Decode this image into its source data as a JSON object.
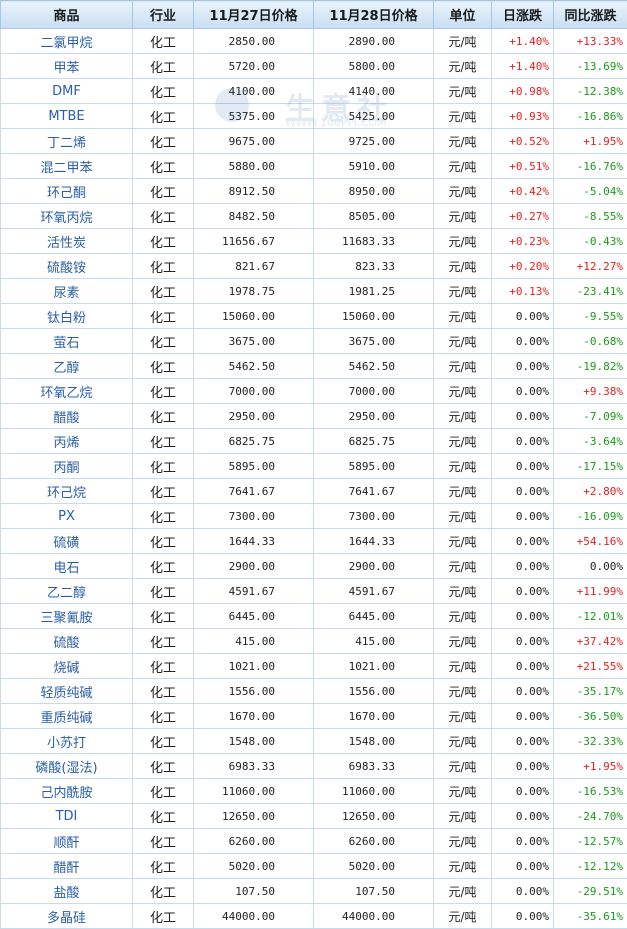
{
  "headers": [
    "商品",
    "行业",
    "11月27日价格",
    "11月28日价格",
    "单位",
    "日涨跌",
    "同比涨跌"
  ],
  "watermark": {
    "brand": "生意社",
    "site": "WWW.100PPI.COM"
  },
  "rows": [
    {
      "name": "二氯甲烷",
      "industry": "化工",
      "p1": "2850.00",
      "p2": "2890.00",
      "unit": "元/吨",
      "day": "+1.40%",
      "yoy": "+13.33%"
    },
    {
      "name": "甲苯",
      "industry": "化工",
      "p1": "5720.00",
      "p2": "5800.00",
      "unit": "元/吨",
      "day": "+1.40%",
      "yoy": "-13.69%"
    },
    {
      "name": "DMF",
      "industry": "化工",
      "p1": "4100.00",
      "p2": "4140.00",
      "unit": "元/吨",
      "day": "+0.98%",
      "yoy": "-12.38%"
    },
    {
      "name": "MTBE",
      "industry": "化工",
      "p1": "5375.00",
      "p2": "5425.00",
      "unit": "元/吨",
      "day": "+0.93%",
      "yoy": "-16.86%"
    },
    {
      "name": "丁二烯",
      "industry": "化工",
      "p1": "9675.00",
      "p2": "9725.00",
      "unit": "元/吨",
      "day": "+0.52%",
      "yoy": "+1.95%"
    },
    {
      "name": "混二甲苯",
      "industry": "化工",
      "p1": "5880.00",
      "p2": "5910.00",
      "unit": "元/吨",
      "day": "+0.51%",
      "yoy": "-16.76%"
    },
    {
      "name": "环己酮",
      "industry": "化工",
      "p1": "8912.50",
      "p2": "8950.00",
      "unit": "元/吨",
      "day": "+0.42%",
      "yoy": "-5.04%"
    },
    {
      "name": "环氧丙烷",
      "industry": "化工",
      "p1": "8482.50",
      "p2": "8505.00",
      "unit": "元/吨",
      "day": "+0.27%",
      "yoy": "-8.55%"
    },
    {
      "name": "活性炭",
      "industry": "化工",
      "p1": "11656.67",
      "p2": "11683.33",
      "unit": "元/吨",
      "day": "+0.23%",
      "yoy": "-0.43%"
    },
    {
      "name": "硫酸铵",
      "industry": "化工",
      "p1": "821.67",
      "p2": "823.33",
      "unit": "元/吨",
      "day": "+0.20%",
      "yoy": "+12.27%"
    },
    {
      "name": "尿素",
      "industry": "化工",
      "p1": "1978.75",
      "p2": "1981.25",
      "unit": "元/吨",
      "day": "+0.13%",
      "yoy": "-23.41%"
    },
    {
      "name": "钛白粉",
      "industry": "化工",
      "p1": "15060.00",
      "p2": "15060.00",
      "unit": "元/吨",
      "day": "0.00%",
      "yoy": "-9.55%"
    },
    {
      "name": "萤石",
      "industry": "化工",
      "p1": "3675.00",
      "p2": "3675.00",
      "unit": "元/吨",
      "day": "0.00%",
      "yoy": "-0.68%"
    },
    {
      "name": "乙醇",
      "industry": "化工",
      "p1": "5462.50",
      "p2": "5462.50",
      "unit": "元/吨",
      "day": "0.00%",
      "yoy": "-19.82%"
    },
    {
      "name": "环氧乙烷",
      "industry": "化工",
      "p1": "7000.00",
      "p2": "7000.00",
      "unit": "元/吨",
      "day": "0.00%",
      "yoy": "+9.38%"
    },
    {
      "name": "醋酸",
      "industry": "化工",
      "p1": "2950.00",
      "p2": "2950.00",
      "unit": "元/吨",
      "day": "0.00%",
      "yoy": "-7.09%"
    },
    {
      "name": "丙烯",
      "industry": "化工",
      "p1": "6825.75",
      "p2": "6825.75",
      "unit": "元/吨",
      "day": "0.00%",
      "yoy": "-3.64%"
    },
    {
      "name": "丙酮",
      "industry": "化工",
      "p1": "5895.00",
      "p2": "5895.00",
      "unit": "元/吨",
      "day": "0.00%",
      "yoy": "-17.15%"
    },
    {
      "name": "环己烷",
      "industry": "化工",
      "p1": "7641.67",
      "p2": "7641.67",
      "unit": "元/吨",
      "day": "0.00%",
      "yoy": "+2.80%"
    },
    {
      "name": "PX",
      "industry": "化工",
      "p1": "7300.00",
      "p2": "7300.00",
      "unit": "元/吨",
      "day": "0.00%",
      "yoy": "-16.09%"
    },
    {
      "name": "硫磺",
      "industry": "化工",
      "p1": "1644.33",
      "p2": "1644.33",
      "unit": "元/吨",
      "day": "0.00%",
      "yoy": "+54.16%"
    },
    {
      "name": "电石",
      "industry": "化工",
      "p1": "2900.00",
      "p2": "2900.00",
      "unit": "元/吨",
      "day": "0.00%",
      "yoy": "0.00%"
    },
    {
      "name": "乙二醇",
      "industry": "化工",
      "p1": "4591.67",
      "p2": "4591.67",
      "unit": "元/吨",
      "day": "0.00%",
      "yoy": "+11.99%"
    },
    {
      "name": "三聚氰胺",
      "industry": "化工",
      "p1": "6445.00",
      "p2": "6445.00",
      "unit": "元/吨",
      "day": "0.00%",
      "yoy": "-12.01%"
    },
    {
      "name": "硫酸",
      "industry": "化工",
      "p1": "415.00",
      "p2": "415.00",
      "unit": "元/吨",
      "day": "0.00%",
      "yoy": "+37.42%"
    },
    {
      "name": "烧碱",
      "industry": "化工",
      "p1": "1021.00",
      "p2": "1021.00",
      "unit": "元/吨",
      "day": "0.00%",
      "yoy": "+21.55%"
    },
    {
      "name": "轻质纯碱",
      "industry": "化工",
      "p1": "1556.00",
      "p2": "1556.00",
      "unit": "元/吨",
      "day": "0.00%",
      "yoy": "-35.17%"
    },
    {
      "name": "重质纯碱",
      "industry": "化工",
      "p1": "1670.00",
      "p2": "1670.00",
      "unit": "元/吨",
      "day": "0.00%",
      "yoy": "-36.50%"
    },
    {
      "name": "小苏打",
      "industry": "化工",
      "p1": "1548.00",
      "p2": "1548.00",
      "unit": "元/吨",
      "day": "0.00%",
      "yoy": "-32.33%"
    },
    {
      "name": "磷酸(湿法)",
      "industry": "化工",
      "p1": "6983.33",
      "p2": "6983.33",
      "unit": "元/吨",
      "day": "0.00%",
      "yoy": "+1.95%"
    },
    {
      "name": "己内酰胺",
      "industry": "化工",
      "p1": "11060.00",
      "p2": "11060.00",
      "unit": "元/吨",
      "day": "0.00%",
      "yoy": "-16.53%"
    },
    {
      "name": "TDI",
      "industry": "化工",
      "p1": "12650.00",
      "p2": "12650.00",
      "unit": "元/吨",
      "day": "0.00%",
      "yoy": "-24.70%"
    },
    {
      "name": "顺酐",
      "industry": "化工",
      "p1": "6260.00",
      "p2": "6260.00",
      "unit": "元/吨",
      "day": "0.00%",
      "yoy": "-12.57%"
    },
    {
      "name": "醋酐",
      "industry": "化工",
      "p1": "5020.00",
      "p2": "5020.00",
      "unit": "元/吨",
      "day": "0.00%",
      "yoy": "-12.12%"
    },
    {
      "name": "盐酸",
      "industry": "化工",
      "p1": "107.50",
      "p2": "107.50",
      "unit": "元/吨",
      "day": "0.00%",
      "yoy": "-29.51%"
    },
    {
      "name": "多晶硅",
      "industry": "化工",
      "p1": "44000.00",
      "p2": "44000.00",
      "unit": "元/吨",
      "day": "0.00%",
      "yoy": "-35.61%"
    }
  ]
}
